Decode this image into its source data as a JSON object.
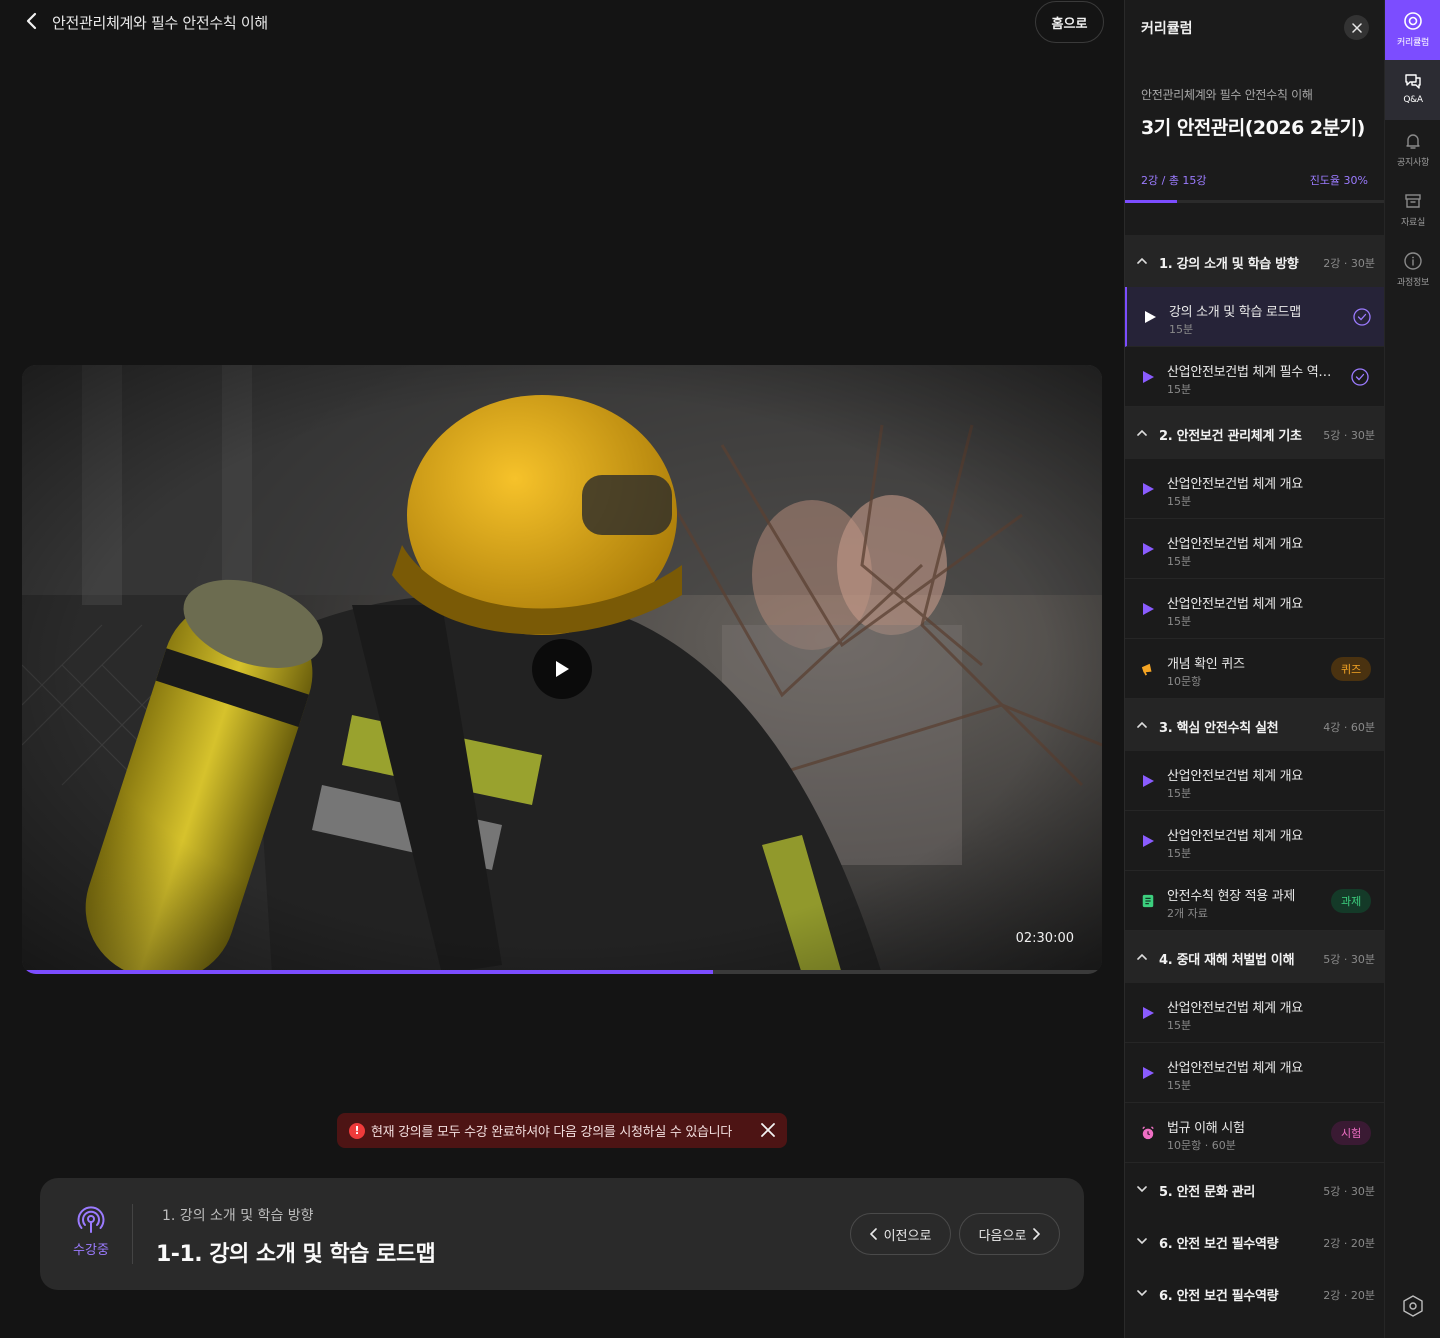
{
  "header": {
    "course_title": "안전관리체계와 필수 안전수칙 이해",
    "home_label": "홈으로"
  },
  "video": {
    "duration": "02:30:00",
    "progress": 0.64,
    "play_icon": "play-icon"
  },
  "toast": {
    "message": "현재 강의를 모두 수강 완료하셔야 다음 강의를 시청하실 수 있습니다"
  },
  "lesson_card": {
    "status_label": "수강중",
    "section_title": "1. 강의 소개 및 학습 방향",
    "lesson_title": "1-1.  강의 소개 및 학습 로드맵",
    "prev_label": "이전으로",
    "next_label": "다음으로"
  },
  "sidebar": {
    "title": "커리큘럼",
    "course_name": "안전관리체계와 필수 안전수칙 이해",
    "term": "3기 안전관리(2026 2분기)",
    "lecture_count": "2강 / 총 15강",
    "progress_rate": "진도율 30%",
    "progress": 0.2,
    "sections": [
      {
        "title": "1. 강의 소개 및 학습 방향",
        "meta": "2강 · 30분",
        "expanded": true,
        "items": [
          {
            "title": "강의 소개 및 학습 로드맵",
            "sub": "15분",
            "type": "video",
            "done": true,
            "active": true
          },
          {
            "title": "산업안전보건법 체계 필수 역량 이해",
            "sub": "15분",
            "type": "video",
            "done": true
          }
        ]
      },
      {
        "title": "2. 안전보건 관리체계 기초",
        "meta": "5강 · 30분",
        "expanded": true,
        "items": [
          {
            "title": "산업안전보건법 체계 개요",
            "sub": "15분",
            "type": "video"
          },
          {
            "title": "산업안전보건법 체계 개요",
            "sub": "15분",
            "type": "video"
          },
          {
            "title": "산업안전보건법 체계 개요",
            "sub": "15분",
            "type": "video"
          },
          {
            "title": "개념 확인 퀴즈",
            "sub": "10문항",
            "type": "quiz",
            "badge": "퀴즈"
          }
        ]
      },
      {
        "title": "3. 핵심 안전수칙 실천",
        "meta": "4강 · 60분",
        "expanded": true,
        "items": [
          {
            "title": "산업안전보건법 체계 개요",
            "sub": "15분",
            "type": "video"
          },
          {
            "title": "산업안전보건법 체계 개요",
            "sub": "15분",
            "type": "video"
          },
          {
            "title": "안전수칙 현장 적용 과제",
            "sub": "2개 자료",
            "type": "task",
            "badge": "과제"
          }
        ]
      },
      {
        "title": "4. 중대 재해 처벌법 이해",
        "meta": "5강 · 30분",
        "expanded": true,
        "items": [
          {
            "title": "산업안전보건법 체계 개요",
            "sub": "15분",
            "type": "video"
          },
          {
            "title": "산업안전보건법 체계 개요",
            "sub": "15분",
            "type": "video"
          },
          {
            "title": "법규 이해 시험",
            "sub": "10문항 · 60분",
            "type": "exam",
            "badge": "시험"
          }
        ]
      },
      {
        "title": "5. 안전 문화 관리",
        "meta": "5강 · 30분",
        "expanded": false,
        "items": []
      },
      {
        "title": "6. 안전 보건 필수역량",
        "meta": "2강 · 20분",
        "expanded": false,
        "items": []
      },
      {
        "title": "6. 안전 보건 필수역량",
        "meta": "2강 · 20분",
        "expanded": false,
        "items": []
      }
    ]
  },
  "rail": {
    "items": [
      {
        "label": "커리큘럼",
        "icon": "curriculum-icon"
      },
      {
        "label": "Q&A",
        "icon": "chat-bubbles-icon"
      },
      {
        "label": "공지사항",
        "icon": "bell-icon"
      },
      {
        "label": "자료실",
        "icon": "archive-box-icon"
      },
      {
        "label": "과정정보",
        "icon": "info-circle-icon"
      }
    ],
    "settings_icon": "settings-hexagon-icon"
  },
  "colors": {
    "accent": "#7c4dff",
    "background": "#141414",
    "sidebar": "#1b1b1b",
    "quiz": "#f5a524",
    "task": "#3ccf7e",
    "exam": "#ef6fc4",
    "error": "#ef3b3b"
  }
}
